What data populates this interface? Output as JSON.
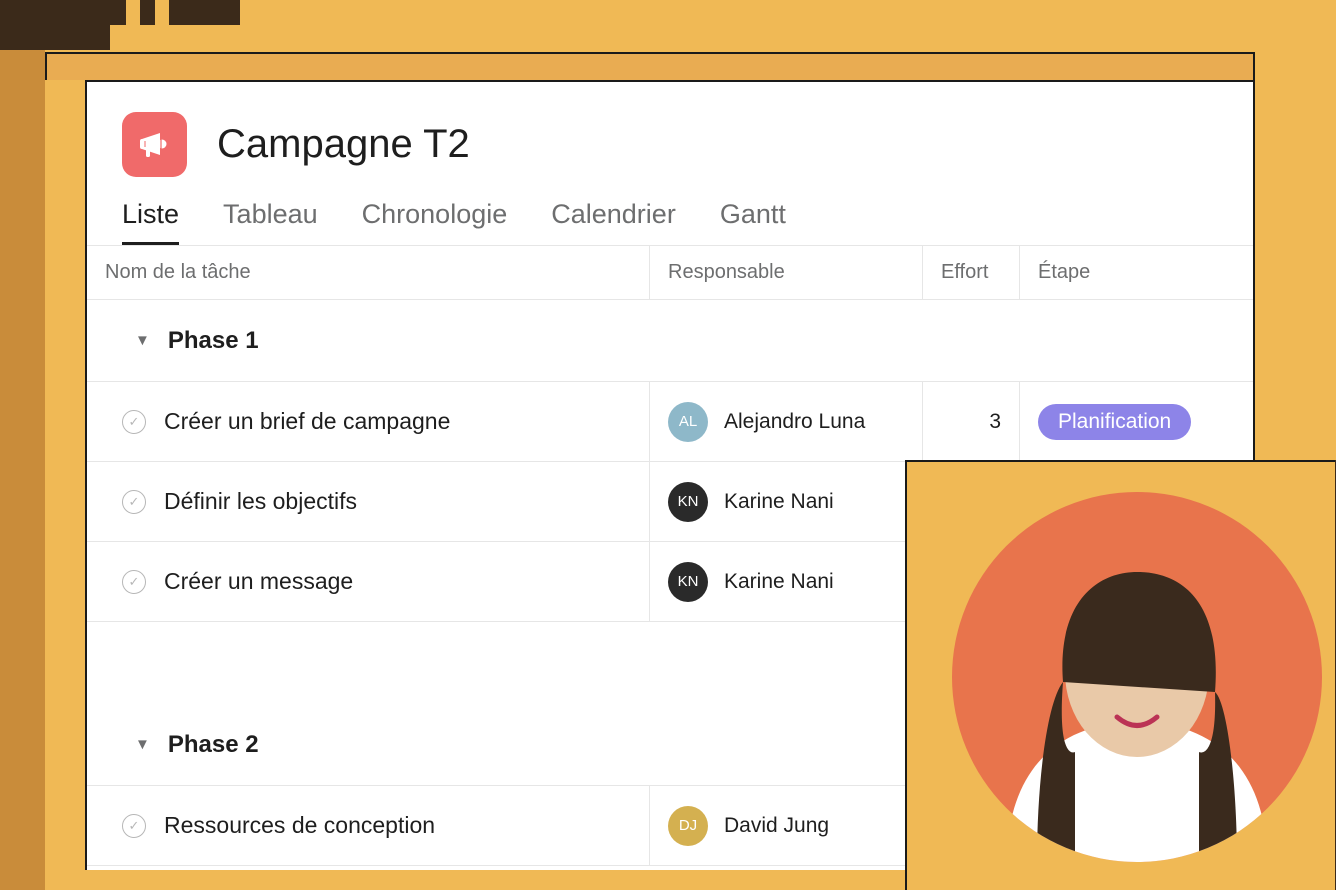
{
  "header": {
    "icon": "megaphone-icon",
    "title": "Campagne T2"
  },
  "tabs": [
    {
      "label": "Liste",
      "active": true
    },
    {
      "label": "Tableau",
      "active": false
    },
    {
      "label": "Chronologie",
      "active": false
    },
    {
      "label": "Calendrier",
      "active": false
    },
    {
      "label": "Gantt",
      "active": false
    }
  ],
  "columns": {
    "name": "Nom de la tâche",
    "responsible": "Responsable",
    "effort": "Effort",
    "stage": "Étape"
  },
  "sections": [
    {
      "title": "Phase 1",
      "tasks": [
        {
          "name": "Créer un brief de campagne",
          "responsible": "Alejandro Luna",
          "avatarClass": "av-1",
          "initials": "AL",
          "effort": "3",
          "stage": "Planification"
        },
        {
          "name": "Définir les objectifs",
          "responsible": "Karine Nani",
          "avatarClass": "av-2",
          "initials": "KN",
          "effort": "",
          "stage": ""
        },
        {
          "name": "Créer un message",
          "responsible": "Karine Nani",
          "avatarClass": "av-2",
          "initials": "KN",
          "effort": "",
          "stage": ""
        }
      ]
    },
    {
      "title": "Phase 2",
      "tasks": [
        {
          "name": "Ressources de conception",
          "responsible": "David Jung",
          "avatarClass": "av-3",
          "initials": "DJ",
          "effort": "",
          "stage": ""
        }
      ]
    }
  ],
  "colors": {
    "accent": "#f06a6a",
    "stagePill": "#8d84e8",
    "bgFrame": "#f0b955",
    "overlayCircle": "#e8744c"
  }
}
